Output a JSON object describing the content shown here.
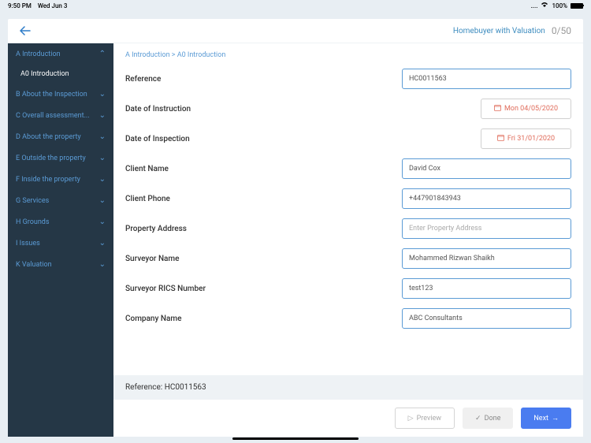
{
  "statusBar": {
    "time": "9:50 PM",
    "date": "Wed Jun 3",
    "batteryPercent": "100%"
  },
  "header": {
    "title": "Homebuyer with Valuation",
    "counter": "0/50"
  },
  "breadcrumb": "A Introduction > A0 Introduction",
  "sidebar": {
    "items": [
      {
        "label": "A Introduction",
        "expanded": true
      },
      {
        "label": "A0 Introduction",
        "sub": true
      },
      {
        "label": "B About the Inspection"
      },
      {
        "label": "C Overall assessment..."
      },
      {
        "label": "D About the property"
      },
      {
        "label": "E Outside the property"
      },
      {
        "label": "F Inside the property"
      },
      {
        "label": "G Services"
      },
      {
        "label": "H Grounds"
      },
      {
        "label": "I Issues"
      },
      {
        "label": "K Valuation"
      }
    ]
  },
  "form": {
    "reference": {
      "label": "Reference",
      "value": "HC0011563"
    },
    "dateInstruction": {
      "label": "Date of Instruction",
      "value": "Mon 04/05/2020"
    },
    "dateInspection": {
      "label": "Date of Inspection",
      "value": "Fri 31/01/2020"
    },
    "clientName": {
      "label": "Client Name",
      "value": "David Cox"
    },
    "clientPhone": {
      "label": "Client Phone",
      "value": "+447901843943"
    },
    "propertyAddress": {
      "label": "Property Address",
      "placeholder": "Enter Property Address"
    },
    "surveyorName": {
      "label": "Surveyor Name",
      "value": "Mohammed Rizwan Shaikh"
    },
    "surveyorRics": {
      "label": "Surveyor RICS Number",
      "value": "test123"
    },
    "companyName": {
      "label": "Company Name",
      "value": "ABC Consultants"
    }
  },
  "referenceBar": "Reference: HC0011563",
  "footer": {
    "preview": "Preview",
    "done": "Done",
    "next": "Next"
  }
}
